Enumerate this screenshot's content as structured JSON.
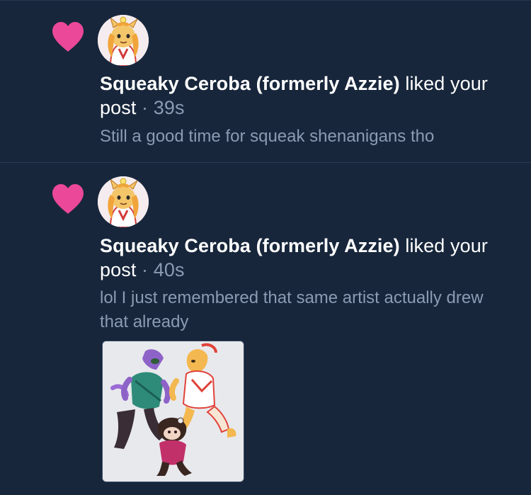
{
  "notifications": [
    {
      "user_name": "Squeaky Ceroba (formerly Azzie)",
      "action": "liked",
      "object": "your post",
      "separator": "·",
      "time": "39s",
      "snippet": "Still a good time for squeak shenanigans tho",
      "icon": "heart-icon",
      "icon_color": "#ec4899"
    },
    {
      "user_name": "Squeaky Ceroba (formerly Azzie)",
      "action": "liked",
      "object": "your post",
      "separator": "·",
      "time": "40s",
      "snippet": "lol I just remembered that same artist actually drew that already",
      "icon": "heart-icon",
      "icon_color": "#ec4899",
      "has_image": true
    }
  ],
  "colors": {
    "background": "#17263b",
    "text_primary": "#ffffff",
    "text_muted": "#8b9bb1",
    "divider": "#2a3b54",
    "heart": "#ec4899"
  }
}
